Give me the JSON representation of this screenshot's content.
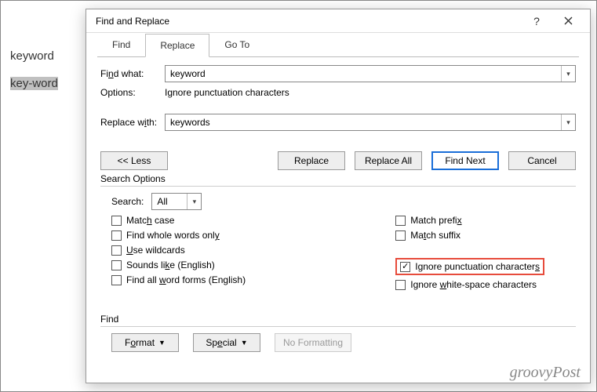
{
  "doc": {
    "word1": "keyword",
    "word2": "key-word"
  },
  "dialog": {
    "title": "Find and Replace",
    "tabs": {
      "find": "Find",
      "replace": "Replace",
      "goto": "Go To"
    },
    "find_what_label": "Find what:",
    "find_what_value": "keyword",
    "options_label": "Options:",
    "options_value": "Ignore punctuation characters",
    "replace_with_label": "Replace with:",
    "replace_with_value": "keywords",
    "buttons": {
      "less": "<< Less",
      "replace": "Replace",
      "replace_all": "Replace All",
      "find_next": "Find Next",
      "cancel": "Cancel"
    },
    "search_options_title": "Search Options",
    "search_label": "Search:",
    "search_value": "All",
    "checkboxes": {
      "match_case": "Match case",
      "whole_words": "Find whole words only",
      "use_wildcards": "Use wildcards",
      "sounds_like": "Sounds like (English)",
      "word_forms": "Find all word forms (English)",
      "match_prefix": "Match prefix",
      "match_suffix": "Match suffix",
      "ignore_punct": "Ignore punctuation characters",
      "ignore_ws": "Ignore white-space characters"
    },
    "find_title": "Find",
    "format_btn": "Format",
    "special_btn": "Special",
    "no_formatting_btn": "No Formatting"
  },
  "watermark": "groovyPost"
}
